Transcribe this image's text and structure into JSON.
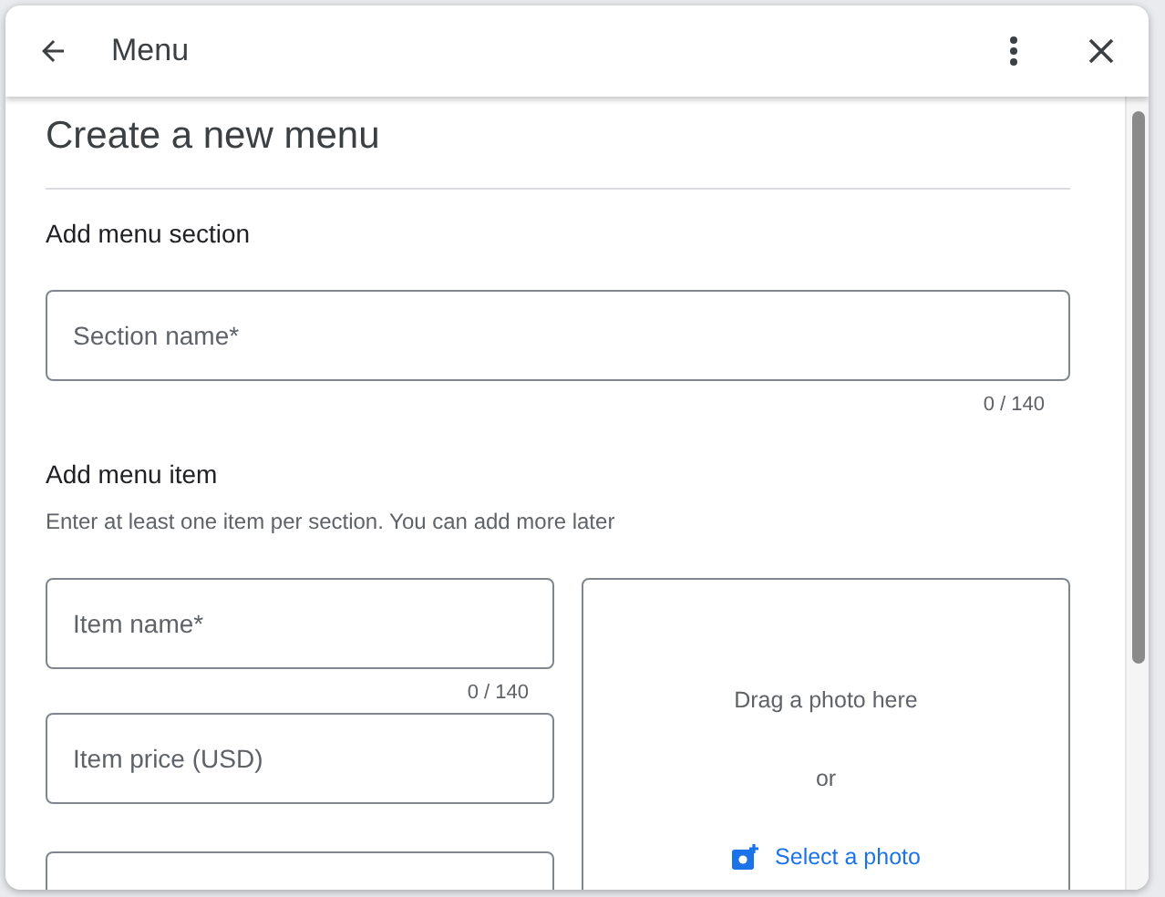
{
  "header": {
    "title": "Menu"
  },
  "heading": "Create a new menu",
  "section": {
    "title": "Add menu section",
    "field": {
      "placeholder": "Section name*",
      "counter": "0 / 140"
    }
  },
  "item": {
    "title": "Add menu item",
    "hint": "Enter at least one item per section. You can add more later",
    "fields": [
      {
        "placeholder": "Item name*",
        "counter": "0 / 140"
      },
      {
        "placeholder": "Item price (USD)"
      }
    ],
    "cut_off_field_below": true,
    "photo": {
      "drag_text": "Drag a photo here",
      "or_text": "or",
      "select_link": "Select a photo"
    }
  }
}
